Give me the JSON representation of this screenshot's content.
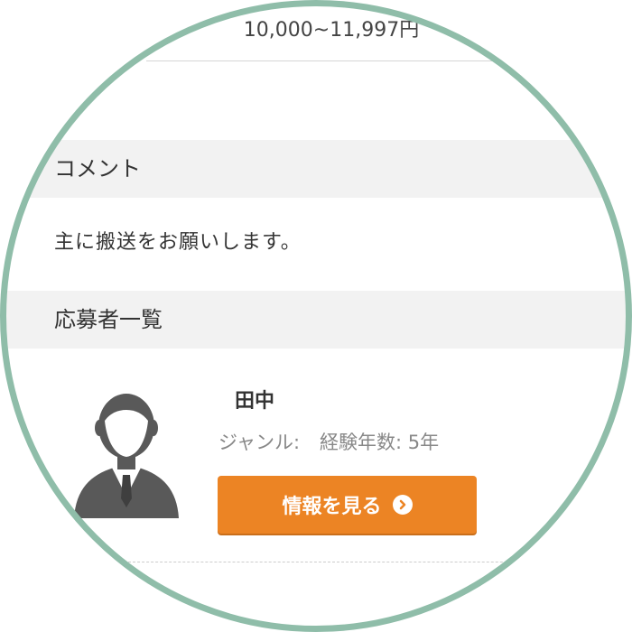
{
  "job": {
    "price_range": "10,000~11,997円"
  },
  "comment": {
    "heading": "コメント",
    "text": "主に搬送をお願いします。"
  },
  "applicants": {
    "heading": "応募者一覧",
    "items": [
      {
        "name": "田中",
        "genre_label": "ジャンル:",
        "experience": "経験年数: 5年",
        "button_label": "情報を見る",
        "button_icon": "chevron-right-circle-icon",
        "avatar_icon": "person-silhouette-icon"
      }
    ]
  },
  "colors": {
    "accent_button": "#ec8424",
    "frame_ring": "#8fbda9",
    "section_bg": "#f2f2f2"
  }
}
